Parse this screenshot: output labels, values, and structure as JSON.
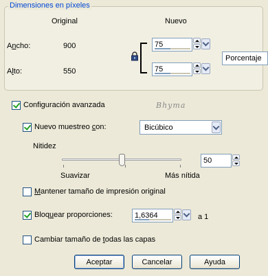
{
  "pixel_dimensions": {
    "title": "Dimensiones en píxeles",
    "header_original": "Original",
    "header_new": "Nuevo",
    "width_label_prefix": "A",
    "width_label_accel": "n",
    "width_label_suffix": "cho:",
    "height_label_prefix": "A",
    "height_label_accel": "l",
    "height_label_suffix": "to:",
    "original_width": "900",
    "original_height": "550",
    "new_width": "75",
    "new_height": "75",
    "unit": "Porcentaje",
    "lock_icon": "padlock-icon"
  },
  "advanced": {
    "label": "Configuración avanzada",
    "checked": true,
    "watermark": "Bhyma"
  },
  "resample": {
    "label_prefix": "Nuevo muestreo ",
    "label_accel": "c",
    "label_suffix": "on:",
    "checked": true,
    "method": "Bicúbico"
  },
  "sharpness": {
    "label": "Nitidez",
    "left_label": "Suavizar",
    "right_label": "Más nítida",
    "value": "50",
    "level": 0.5
  },
  "keep_print_size": {
    "label_accel": "M",
    "label_rest": "antener tamaño de impresión original",
    "checked": false
  },
  "lock_ratio": {
    "label_prefix": "Bloq",
    "label_accel": "u",
    "label_suffix": "ear proporciones:",
    "checked": true,
    "value": "1,6364",
    "suffix": "a 1"
  },
  "all_layers": {
    "label_prefix": "Cambiar tamaño de ",
    "label_accel": "t",
    "label_suffix": "odas las capas",
    "checked": false
  },
  "buttons": {
    "ok": "Aceptar",
    "cancel": "Cancelar",
    "help": "Ayuda"
  },
  "colors": {
    "dialog_bg": "#ece9d8",
    "group_title": "#0046d5",
    "check_mark": "#21a121"
  }
}
